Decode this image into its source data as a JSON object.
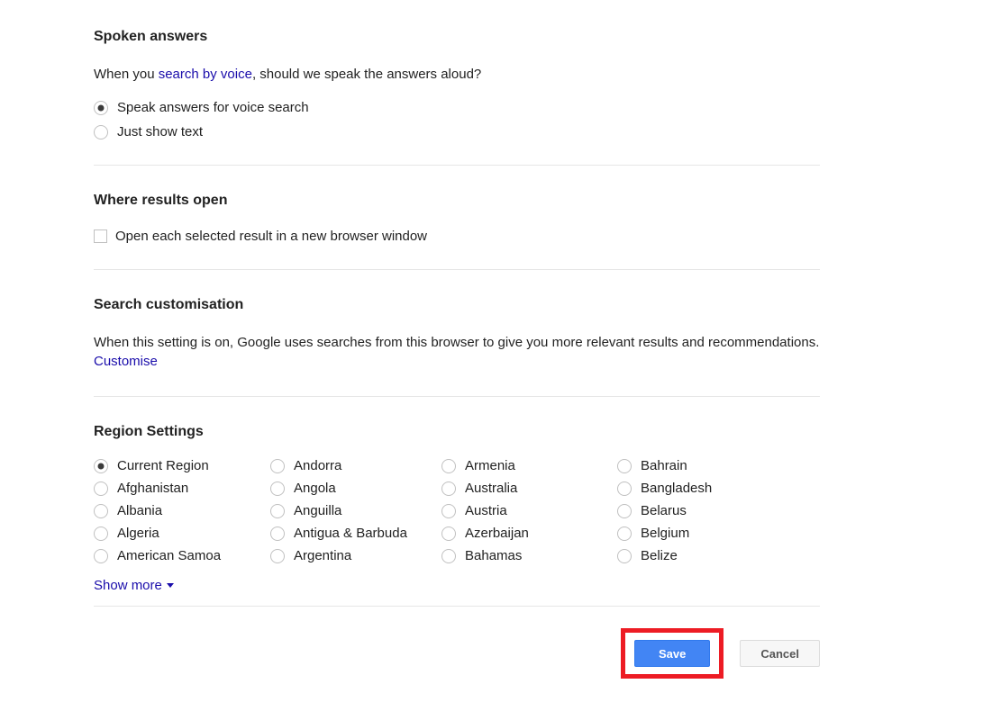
{
  "spoken": {
    "title": "Spoken answers",
    "desc_prefix": "When you ",
    "desc_link": "search by voice",
    "desc_suffix": ", should we speak the answers aloud?",
    "options": [
      {
        "label": "Speak answers for voice search",
        "selected": true
      },
      {
        "label": "Just show text",
        "selected": false
      }
    ]
  },
  "results_open": {
    "title": "Where results open",
    "checkbox_label": "Open each selected result in a new browser window",
    "checked": false
  },
  "search_custom": {
    "title": "Search customisation",
    "desc_text": "When this setting is on, Google uses searches from this browser to give you more relevant results and recommendations. ",
    "customise_link": "Customise"
  },
  "region": {
    "title": "Region Settings",
    "columns": [
      [
        {
          "label": "Current Region",
          "selected": true
        },
        {
          "label": "Afghanistan",
          "selected": false
        },
        {
          "label": "Albania",
          "selected": false
        },
        {
          "label": "Algeria",
          "selected": false
        },
        {
          "label": "American Samoa",
          "selected": false
        }
      ],
      [
        {
          "label": "Andorra",
          "selected": false
        },
        {
          "label": "Angola",
          "selected": false
        },
        {
          "label": "Anguilla",
          "selected": false
        },
        {
          "label": "Antigua & Barbuda",
          "selected": false
        },
        {
          "label": "Argentina",
          "selected": false
        }
      ],
      [
        {
          "label": "Armenia",
          "selected": false
        },
        {
          "label": "Australia",
          "selected": false
        },
        {
          "label": "Austria",
          "selected": false
        },
        {
          "label": "Azerbaijan",
          "selected": false
        },
        {
          "label": "Bahamas",
          "selected": false
        }
      ],
      [
        {
          "label": "Bahrain",
          "selected": false
        },
        {
          "label": "Bangladesh",
          "selected": false
        },
        {
          "label": "Belarus",
          "selected": false
        },
        {
          "label": "Belgium",
          "selected": false
        },
        {
          "label": "Belize",
          "selected": false
        }
      ]
    ],
    "show_more": "Show more"
  },
  "buttons": {
    "save": "Save",
    "cancel": "Cancel"
  }
}
